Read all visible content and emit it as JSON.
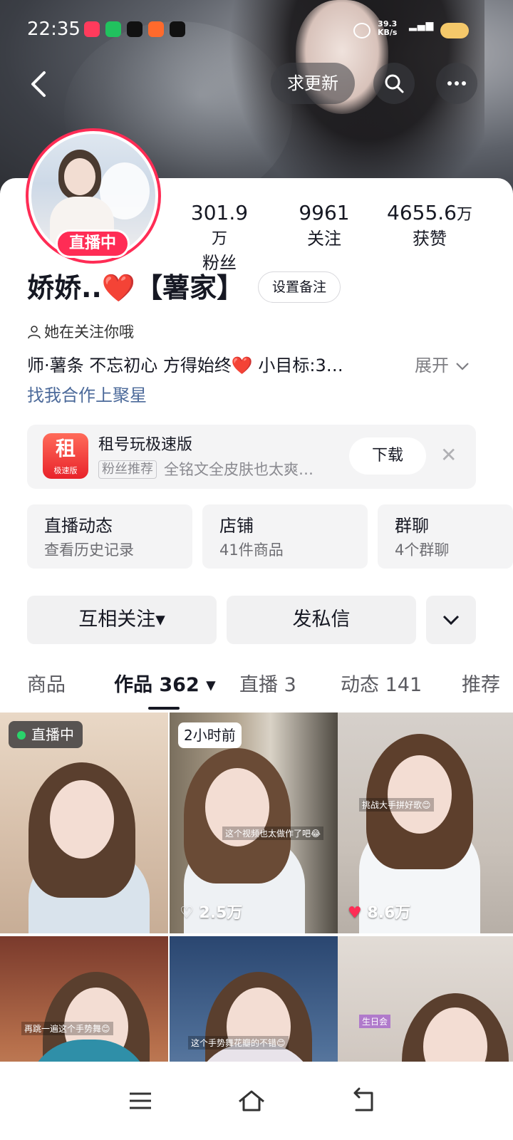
{
  "status_bar": {
    "time": "22:35",
    "speed_value": "39.3",
    "speed_unit": "KB/s"
  },
  "header": {
    "update_button": "求更新"
  },
  "profile": {
    "live_badge": "直播中",
    "stats": [
      {
        "num": "301.9",
        "unit": "万",
        "label": "粉丝"
      },
      {
        "num": "9961",
        "unit": "",
        "label": "关注"
      },
      {
        "num": "4655.6",
        "unit": "万",
        "label": "获赞"
      }
    ],
    "name": "娇娇..❤️【薯家】",
    "set_note_button": "设置备注",
    "follows_you": "她在关注你哦",
    "bio": "师·薯条 不忘初心 方得始终❤️ 小目标:3…",
    "expand": "展开",
    "bio_link": "找我合作上聚星"
  },
  "ad": {
    "logo_text": "租",
    "logo_sub": "极速版",
    "title": "租号玩极速版",
    "tag": "粉丝推荐",
    "desc": "全铭文全皮肤也太爽…",
    "download": "下载"
  },
  "tiles": [
    {
      "title": "直播动态",
      "sub": "查看历史记录"
    },
    {
      "title": "店铺",
      "sub": "41件商品"
    },
    {
      "title": "群聊",
      "sub": "4个群聊"
    }
  ],
  "actions": {
    "mutual_follow": "互相关注▾",
    "message": "发私信"
  },
  "tabs": [
    "商品",
    "作品 362 ▾",
    "直播 3",
    "动态 141",
    "推荐"
  ],
  "grid": [
    {
      "badge": "直播中",
      "likes": ""
    },
    {
      "badge": "2小时前",
      "likes": "2.5万",
      "caption": "这个视频也太做作了吧😂"
    },
    {
      "badge": "",
      "likes": "8.6万",
      "caption": "挑战大手拼好歌😊"
    },
    {
      "badge": "",
      "likes": "",
      "caption": "再跳一遍这个手势舞😊"
    },
    {
      "badge": "",
      "likes": "",
      "caption": "这个手势舞花瓣的不错😊"
    },
    {
      "badge": "",
      "likes": "",
      "caption": "生日会"
    }
  ],
  "colors": {
    "accent": "#ff2c55",
    "link": "#4c6a9a",
    "tile_bg": "#f4f4f5"
  }
}
